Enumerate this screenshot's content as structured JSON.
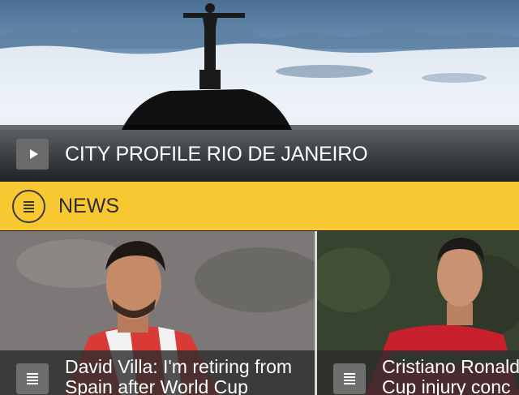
{
  "hero": {
    "title": "CITY PROFILE RIO DE JANEIRO",
    "play_icon": "play-icon"
  },
  "news": {
    "title": "NEWS",
    "icon": "list-icon",
    "accent_color": "#f8c833"
  },
  "articles": [
    {
      "line1": "David Villa: I'm retiring from",
      "line2": "Spain after World Cup",
      "icon": "list-icon"
    },
    {
      "line1": "Cristiano Ronaldo",
      "line2": "Cup injury conc",
      "icon": "list-icon"
    }
  ]
}
